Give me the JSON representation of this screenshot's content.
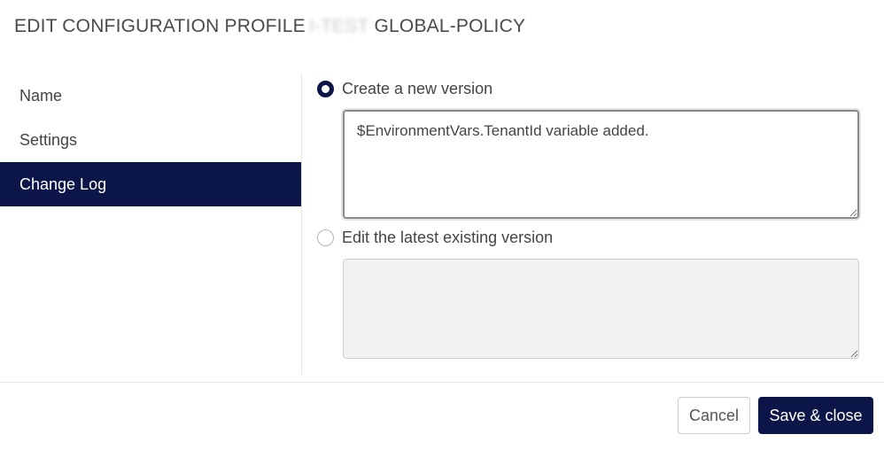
{
  "dialog": {
    "title_prefix": "EDIT CONFIGURATION PROFILE",
    "title_redacted": "I-TEST",
    "title_suffix": "GLOBAL-POLICY"
  },
  "sidebar": {
    "items": [
      {
        "label": "Name"
      },
      {
        "label": "Settings"
      },
      {
        "label": "Change Log"
      }
    ]
  },
  "change_log": {
    "new_version_label": "Create a new version",
    "new_version_text": "$EnvironmentVars.TenantId variable added.",
    "edit_existing_label": "Edit the latest existing version",
    "edit_existing_text": ""
  },
  "footer": {
    "cancel_label": "Cancel",
    "save_label": "Save & close"
  },
  "colors": {
    "accent": "#0b1547"
  }
}
